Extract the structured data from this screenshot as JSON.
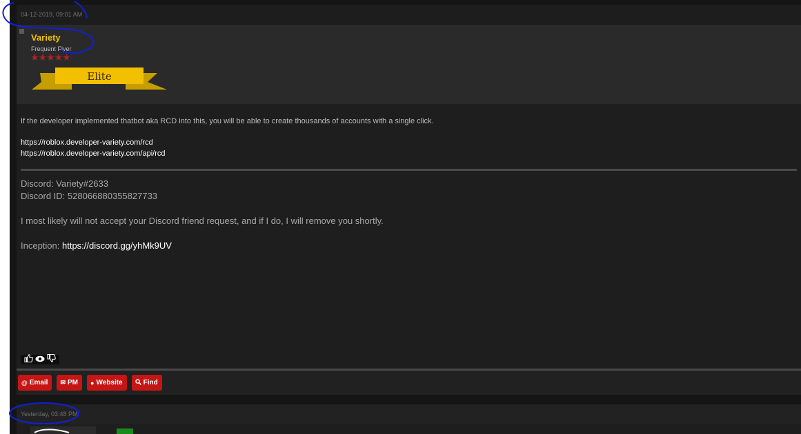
{
  "post1": {
    "date": "04-12-2019, 09:01 AM",
    "author": {
      "name": "Variety",
      "title": "Frequent Flyer",
      "stars": "★★★★★",
      "rank_label": "Elite"
    },
    "body": {
      "paragraph": "If the developer implemented thatbot aka RCD into this, you will be able to create thousands of accounts with a single click.",
      "links": [
        "https://roblox.developer-variety.com/rcd",
        "https://roblox.developer-variety.com/api/rcd"
      ]
    },
    "signature": {
      "discord": "Discord: Variety#2633",
      "discord_id": "Discord ID: 528066880355827733",
      "notice": "I most likely will not accept your Discord friend request, and if I do, I will remove you shortly.",
      "inception_label": "Inception: ",
      "inception_link": "https://discord.gg/yhMk9UV"
    },
    "rating_icons": [
      "thumbs-up-icon",
      "eye-icon",
      "thumbs-down-icon"
    ],
    "actions": [
      {
        "label": "Email",
        "icon": "at-icon"
      },
      {
        "label": "PM",
        "icon": "mail-icon"
      },
      {
        "label": "Website",
        "icon": "globe-icon"
      },
      {
        "label": "Find",
        "icon": "search-icon"
      }
    ]
  },
  "post2": {
    "date": "Yesterday, 03:48 PM"
  },
  "colors": {
    "username": "#f3c000",
    "button": "#c51616",
    "star": "#a6242a",
    "banner": "#f3c000",
    "annotation": "#1020d8"
  }
}
